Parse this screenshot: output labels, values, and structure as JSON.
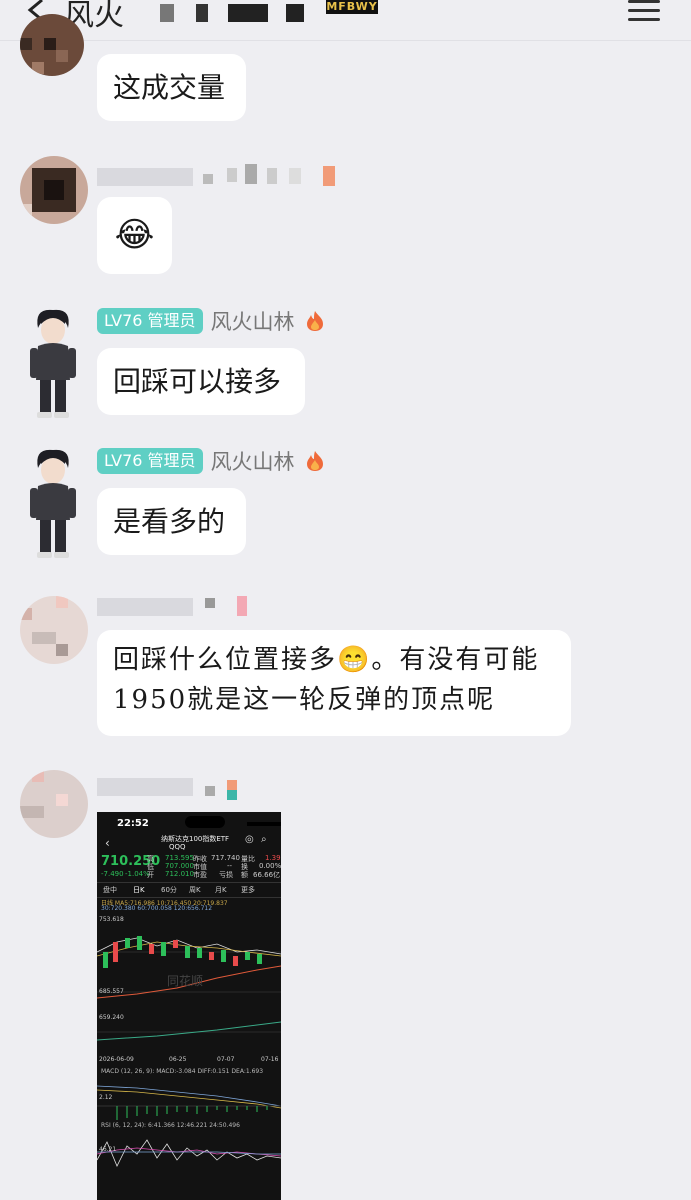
{
  "header": {
    "title": "风火",
    "badge": "MFBWY"
  },
  "messages": [
    {
      "text": "这成交量"
    },
    {
      "emoji": "😂"
    },
    {
      "level": "LV76 管理员",
      "nickname": "风火山林",
      "text": "回踩可以接多"
    },
    {
      "level": "LV76 管理员",
      "nickname": "风火山林",
      "text": "是看多的"
    },
    {
      "line1": "回踩什么位置接多😁。有没有可能",
      "line2": "1950就是这一轮反弹的顶点呢"
    }
  ],
  "stock_screenshot": {
    "time": "22:52",
    "name": "纳斯达克100指数ETF",
    "code": "QQQ",
    "price": "710.250",
    "change": "-7.490",
    "change_pct": "-1.04%",
    "high_label": "高",
    "high": "713.595",
    "low_label": "低",
    "low": "707.000",
    "open_label": "开",
    "open": "712.010",
    "prev_label": "昨收",
    "prev": "717.740",
    "mcap_label": "市值",
    "mcap": "--",
    "pe_label": "市盈",
    "pe": "亏损",
    "vol_label": "量比",
    "vol": "1.39",
    "turn_label": "换",
    "turn": "0.00%",
    "amount_label": "额",
    "amount": "66.66亿",
    "tabs": [
      "盘中",
      "日K",
      "60分",
      "周K",
      "月K",
      "更多"
    ],
    "ma_line1": "日线  MA5:716.986  10:716.450  20:719.837",
    "ma_line2": "30:720.380  60:700.058  120:656.712",
    "y_top": "753.618",
    "y_mid": "685.557",
    "y_low": "659.240",
    "dates": [
      "2026-06-09",
      "06-25",
      "07-07",
      "07-16"
    ],
    "macd_label": "MACD (12, 26, 9):  MACD:-3.084  DIFF:0.151  DEA:1.693",
    "macd_y": "2.12",
    "rsi_label": "RSI (6, 12, 24):  6:41.366  12:46.221  24:50.496",
    "rsi_y": "46.21",
    "watermark": "同花顺"
  },
  "colors": {
    "up": "#e84b4b",
    "down": "#2dbf5a",
    "lv_badge": "#5fcfc4"
  }
}
